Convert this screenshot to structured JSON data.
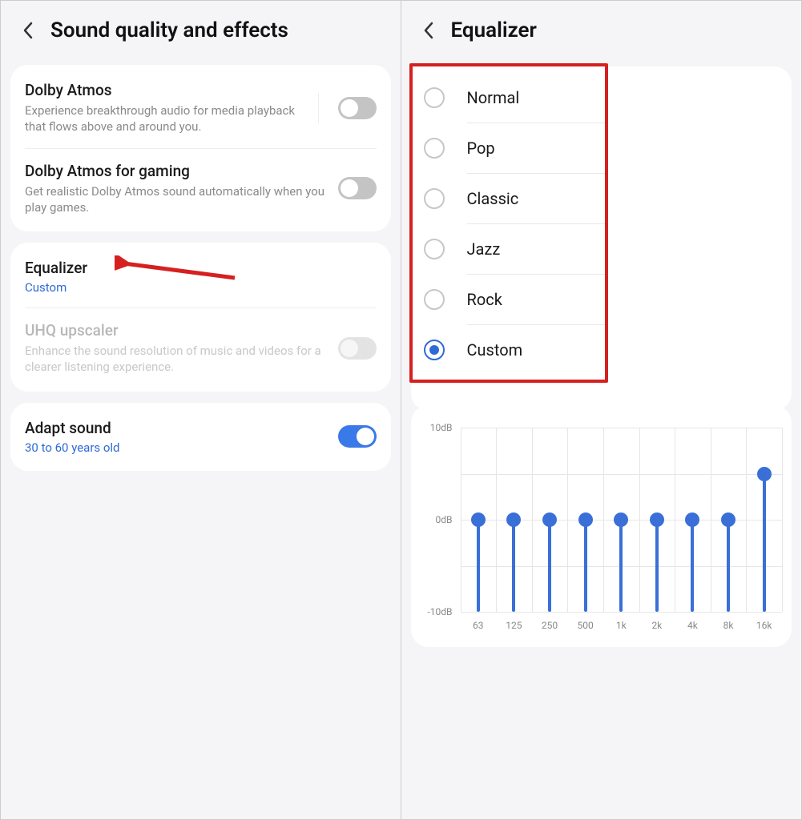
{
  "left": {
    "title": "Sound quality and effects",
    "items": [
      {
        "title": "Dolby Atmos",
        "sub": "Experience breakthrough audio for media playback that flows above and around you.",
        "toggle": "off",
        "separator": true
      },
      {
        "title": "Dolby Atmos for gaming",
        "sub": "Get realistic Dolby Atmos sound automatically when you play games.",
        "toggle": "off"
      }
    ],
    "equalizer": {
      "title": "Equalizer",
      "value": "Custom"
    },
    "uhq": {
      "title": "UHQ upscaler",
      "sub": "Enhance the sound resolution of music and videos for a clearer listening experience."
    },
    "adapt": {
      "title": "Adapt sound",
      "value": "30 to 60 years old"
    }
  },
  "right": {
    "title": "Equalizer",
    "options": [
      "Normal",
      "Pop",
      "Classic",
      "Jazz",
      "Rock",
      "Custom"
    ],
    "selected": "Custom"
  },
  "chart_data": {
    "type": "bar",
    "categories": [
      "63",
      "125",
      "250",
      "500",
      "1k",
      "2k",
      "4k",
      "8k",
      "16k"
    ],
    "values": [
      0,
      0,
      0,
      0,
      0,
      0,
      0,
      0,
      5
    ],
    "ylabels": [
      "10dB",
      "0dB",
      "-10dB"
    ],
    "ylim": [
      -10,
      10
    ]
  },
  "annotation": {
    "arrow_color": "#d62020",
    "highlight_color": "#d62020"
  }
}
